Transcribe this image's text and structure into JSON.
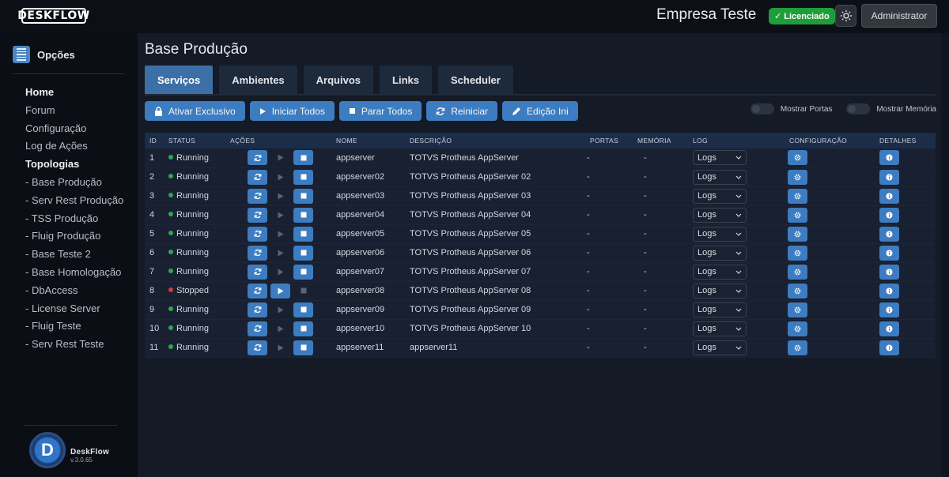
{
  "header": {
    "logo": "DESKFLOW",
    "company": "Empresa Teste",
    "license_badge": "✓ Licenciado",
    "user_button": "Administrator"
  },
  "sidebar": {
    "title": "Opções",
    "items": [
      {
        "label": "Home",
        "bold": true
      },
      {
        "label": "Forum",
        "bold": false
      },
      {
        "label": "Configuração",
        "bold": false
      },
      {
        "label": "Log de Ações",
        "bold": false
      },
      {
        "label": "Topologias",
        "bold": true
      },
      {
        "label": "- Base Produção",
        "bold": false
      },
      {
        "label": "- Serv Rest Produção",
        "bold": false
      },
      {
        "label": "- TSS Produção",
        "bold": false
      },
      {
        "label": "- Fluig Produção",
        "bold": false
      },
      {
        "label": "- Base Teste 2",
        "bold": false
      },
      {
        "label": "- Base Homologação",
        "bold": false
      },
      {
        "label": "- DbAccess",
        "bold": false
      },
      {
        "label": "- License Server",
        "bold": false
      },
      {
        "label": "- Fluig Teste",
        "bold": false
      },
      {
        "label": "- Serv Rest Teste",
        "bold": false
      }
    ],
    "brand_name": "DeskFlow",
    "brand_version": "v.3.0.65"
  },
  "main": {
    "title": "Base Produção",
    "tabs": [
      "Serviços",
      "Ambientes",
      "Arquivos",
      "Links",
      "Scheduler"
    ],
    "active_tab": 0,
    "actions": {
      "exclusive": "Ativar Exclusivo",
      "start_all": "Iniciar Todos",
      "stop_all": "Parar Todos",
      "restart": "Reiniciar",
      "edit_ini": "Edição Ini"
    },
    "toggles": {
      "ports": "Mostrar Portas",
      "memory": "Mostrar Memória"
    }
  },
  "table": {
    "headers": [
      "ID",
      "STATUS",
      "AÇÕES",
      "NOME",
      "DESCRIÇÃO",
      "PORTAS",
      "MEMÓRIA",
      "LOG",
      "CONFIGURAÇÃO",
      "DETALHES"
    ],
    "log_select_value": "Logs",
    "rows": [
      {
        "id": "1",
        "status": "Running",
        "name": "appserver",
        "desc": "TOTVS Protheus AppServer",
        "ports": "-",
        "memory": "-"
      },
      {
        "id": "2",
        "status": "Running",
        "name": "appserver02",
        "desc": "TOTVS Protheus AppServer 02",
        "ports": "-",
        "memory": "-"
      },
      {
        "id": "3",
        "status": "Running",
        "name": "appserver03",
        "desc": "TOTVS Protheus AppServer 03",
        "ports": "-",
        "memory": "-"
      },
      {
        "id": "4",
        "status": "Running",
        "name": "appserver04",
        "desc": "TOTVS Protheus AppServer 04",
        "ports": "-",
        "memory": "-"
      },
      {
        "id": "5",
        "status": "Running",
        "name": "appserver05",
        "desc": "TOTVS Protheus AppServer 05",
        "ports": "-",
        "memory": "-"
      },
      {
        "id": "6",
        "status": "Running",
        "name": "appserver06",
        "desc": "TOTVS Protheus AppServer 06",
        "ports": "-",
        "memory": "-"
      },
      {
        "id": "7",
        "status": "Running",
        "name": "appserver07",
        "desc": "TOTVS Protheus AppServer 07",
        "ports": "-",
        "memory": "-"
      },
      {
        "id": "8",
        "status": "Stopped",
        "name": "appserver08",
        "desc": "TOTVS Protheus AppServer 08",
        "ports": "-",
        "memory": "-"
      },
      {
        "id": "9",
        "status": "Running",
        "name": "appserver09",
        "desc": "TOTVS Protheus AppServer 09",
        "ports": "-",
        "memory": "-"
      },
      {
        "id": "10",
        "status": "Running",
        "name": "appserver10",
        "desc": "TOTVS Protheus AppServer 10",
        "ports": "-",
        "memory": "-"
      },
      {
        "id": "11",
        "status": "Running",
        "name": "appserver11",
        "desc": "appserver11",
        "ports": "-",
        "memory": "-"
      }
    ]
  },
  "colors": {
    "accent": "#3d7cc0",
    "running": "#2ea84b",
    "stopped": "#d33a3a",
    "licensed": "#1f9d3a"
  }
}
